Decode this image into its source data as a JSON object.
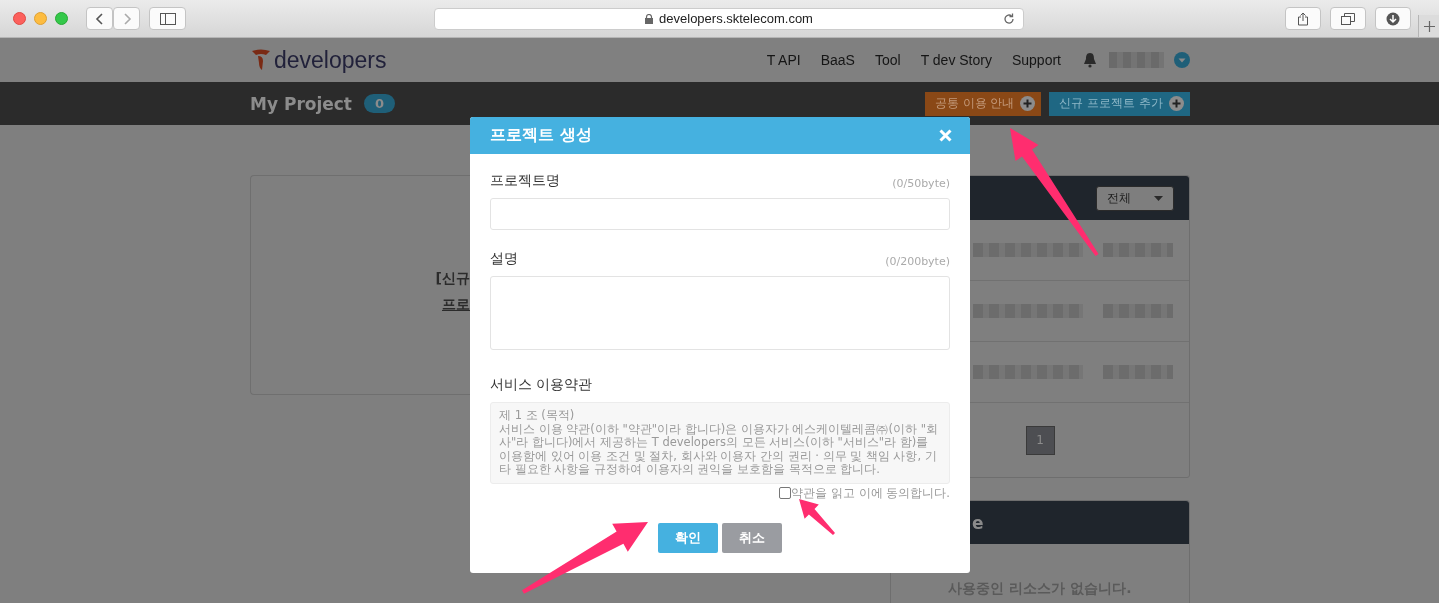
{
  "browser": {
    "url": "developers.sktelecom.com"
  },
  "site": {
    "logo": "developers",
    "nav": [
      "T API",
      "BaaS",
      "Tool",
      "T dev Story",
      "Support"
    ]
  },
  "project_bar": {
    "title": "My Project",
    "count": "0",
    "buttons": [
      {
        "label": "공통 이용 안내",
        "kind": "guide"
      },
      {
        "label": "신규 프로젝트 추가",
        "kind": "add"
      }
    ]
  },
  "card": {
    "lines": [
      "[신규",
      "프로"
    ]
  },
  "panel": {
    "filter": "전체",
    "pages": [
      {
        "label": "1",
        "selected": true
      }
    ]
  },
  "panel2": {
    "title": "e",
    "empty_message": "사용중인 리소스가 없습니다."
  },
  "modal": {
    "title": "프로젝트 생성",
    "fields": [
      {
        "label": "프로젝트명",
        "counter": "(0/50byte)",
        "kind": "input"
      },
      {
        "label": "설명",
        "counter": "(0/200byte)",
        "kind": "textarea"
      }
    ],
    "terms": {
      "label": "서비스 이용약관",
      "paragraphs": [
        "제 1 조 (목적)",
        "서비스 이용 약관(이하 \"약관\"이라 합니다)은 이용자가 에스케이텔레콤㈜(이하 \"회사\"라 합니다)에서 제공하는 T developers의 모든 서비스(이하 \"서비스\"라 함)를 이용함에 있어 이용 조건 및 절차, 회사와 이용자 간의 권리 · 의무 및 책임 사항, 기타 필요한 사항을 규정하여 이용자의 권익을 보호함을 목적으로 합니다."
      ],
      "agree": {
        "label": "약관을 읽고 이에 동의합니다.",
        "checked": false
      }
    },
    "buttons": [
      {
        "label": "확인",
        "kind": "primary"
      },
      {
        "label": "취소",
        "kind": "secondary"
      }
    ]
  }
}
